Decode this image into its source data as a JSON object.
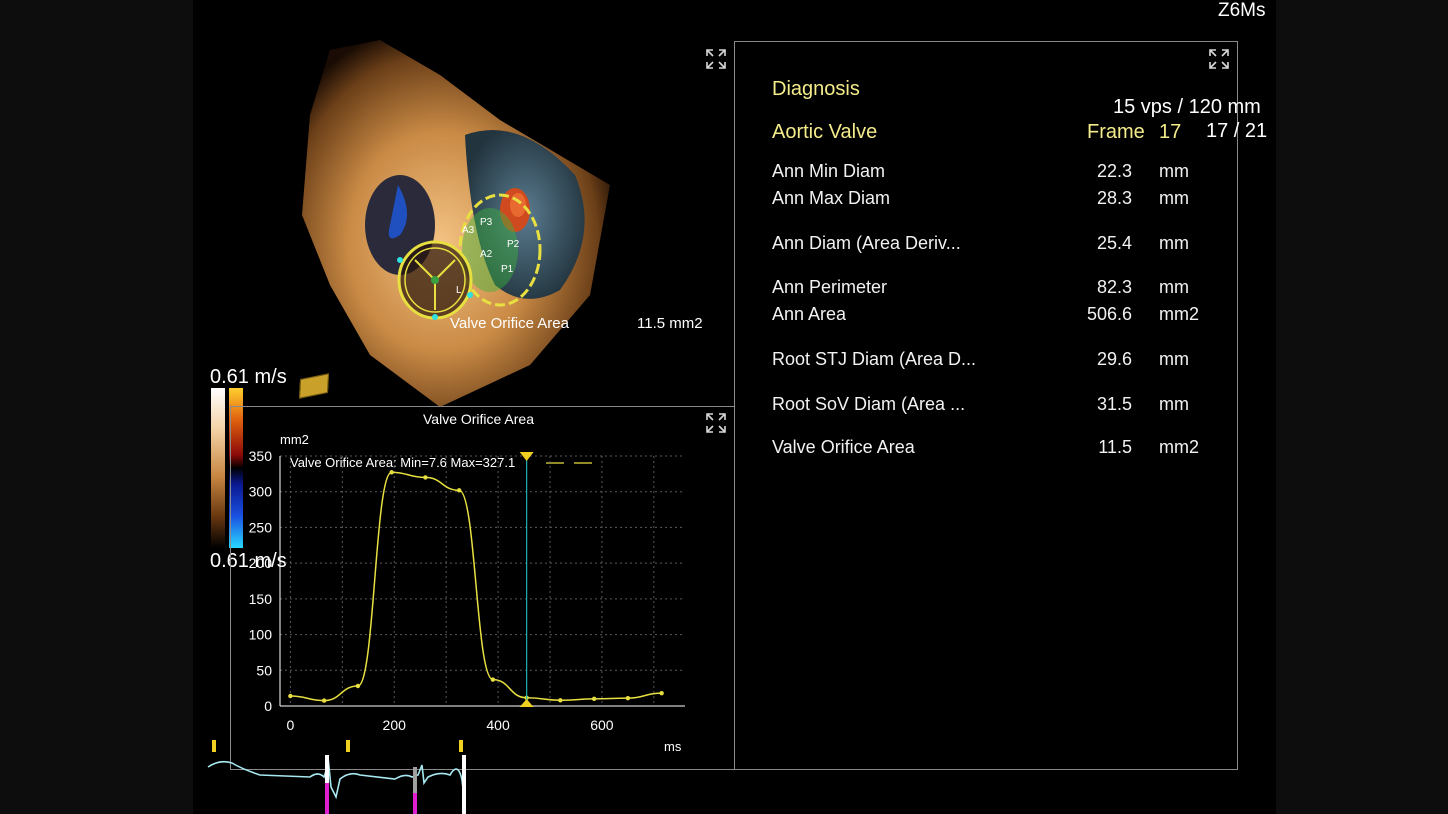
{
  "header": {
    "probe": "Z6Ms",
    "frame_rate": "15 vps / 120 mm",
    "frame_counter": "17 / 21"
  },
  "volume_view": {
    "measurement_label": "Valve Orifice Area",
    "measurement_value": "11.5  mm2",
    "leaflet_labels": [
      "A3",
      "A2",
      "P3",
      "P2",
      "P1",
      "L"
    ]
  },
  "color_scale": {
    "top": "0.61 m/s",
    "bottom": "0.61 m/s",
    "colors": {
      "white": "#ffffff",
      "orange": "#f0a020",
      "red": "#a01010",
      "blue": "#1020a0",
      "cyan": "#20c8f0"
    }
  },
  "chart_panel": {
    "title": "Valve Orifice Area",
    "legend": "Valve Orifice Area: Min=7.6 Max=327.1",
    "line_color": "#e8e040",
    "cursor_color": "#20b0b0"
  },
  "chart_data": {
    "type": "line",
    "title": "Valve Orifice Area",
    "xlabel": "ms",
    "ylabel": "mm2",
    "xlim": [
      -20,
      760
    ],
    "ylim": [
      0,
      350
    ],
    "x_ticks": [
      0,
      200,
      400,
      600
    ],
    "y_ticks": [
      0,
      50,
      100,
      150,
      200,
      250,
      300,
      350
    ],
    "grid": true,
    "series": [
      {
        "name": "Valve Orifice Area",
        "x": [
          0,
          65,
          130,
          195,
          260,
          325,
          390,
          455,
          520,
          585,
          650,
          715
        ],
        "y": [
          14,
          7.6,
          28,
          327.1,
          320,
          302,
          37,
          11.5,
          8,
          10,
          11,
          18
        ]
      }
    ],
    "cursor_x": 455,
    "annotations": [
      "Min=7.6",
      "Max=327.1"
    ]
  },
  "diagnosis": {
    "heading": "Diagnosis",
    "valve": "Aortic Valve",
    "frame_label": "Frame",
    "frame_value": "17",
    "rows": [
      {
        "label": "Ann Min Diam",
        "value": "22.3",
        "unit": "mm"
      },
      {
        "label": "Ann Max Diam",
        "value": "28.3",
        "unit": "mm"
      },
      {
        "label": "Ann Diam (Area Deriv...",
        "value": "25.4",
        "unit": "mm"
      },
      {
        "label": "Ann Perimeter",
        "value": "82.3",
        "unit": "mm"
      },
      {
        "label": "Ann Area",
        "value": "506.6",
        "unit": "mm2"
      },
      {
        "label": "Root STJ Diam (Area D...",
        "value": "29.6",
        "unit": "mm"
      },
      {
        "label": "Root SoV Diam (Area ...",
        "value": "31.5",
        "unit": "mm"
      },
      {
        "label": "Valve Orifice Area",
        "value": "11.5",
        "unit": "mm2"
      }
    ]
  },
  "ecg": {
    "trace_color": "#a8e8f0",
    "marker_colors": [
      "#e020d0",
      "#a0a0a0",
      "#ffffff",
      "#f0d020"
    ]
  }
}
